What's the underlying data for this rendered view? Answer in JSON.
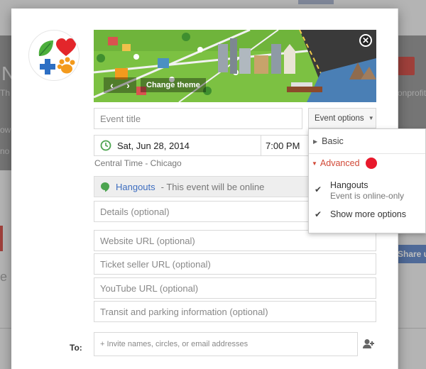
{
  "background": {
    "left_fragments": [
      "N",
      "Th",
      "ow",
      "no",
      "e"
    ],
    "right_fragments": [
      "onprofit"
    ],
    "share_label": "Share u"
  },
  "banner": {
    "change_theme_label": "Change theme",
    "prev_arrow": "‹",
    "next_arrow": "›",
    "close_glyph": "✕"
  },
  "form": {
    "event_title_placeholder": "Event title",
    "event_options_label": "Event options",
    "date": "Sat, Jun 28, 2014",
    "time": "7:00 PM",
    "timezone": "Central Time - Chicago",
    "hangouts_link": "Hangouts",
    "hangouts_hint": "- This event will be online",
    "details_placeholder": "Details (optional)",
    "website_placeholder": "Website URL (optional)",
    "ticket_placeholder": "Ticket seller URL (optional)",
    "youtube_placeholder": "YouTube URL (optional)",
    "transit_placeholder": "Transit and parking information (optional)",
    "to_label": "To:",
    "to_placeholder": "+ Invite names, circles, or email addresses"
  },
  "menu": {
    "basic": "Basic",
    "advanced": "Advanced",
    "items": [
      {
        "label": "Hangouts",
        "sub": "Event is online-only",
        "checked": true
      },
      {
        "label": "Show more options",
        "sub": "",
        "checked": true
      }
    ]
  },
  "colors": {
    "accent_red": "#d14836",
    "link_blue": "#3e6ec0",
    "clock_green": "#4ca44f",
    "dot_red": "#e8192c"
  }
}
